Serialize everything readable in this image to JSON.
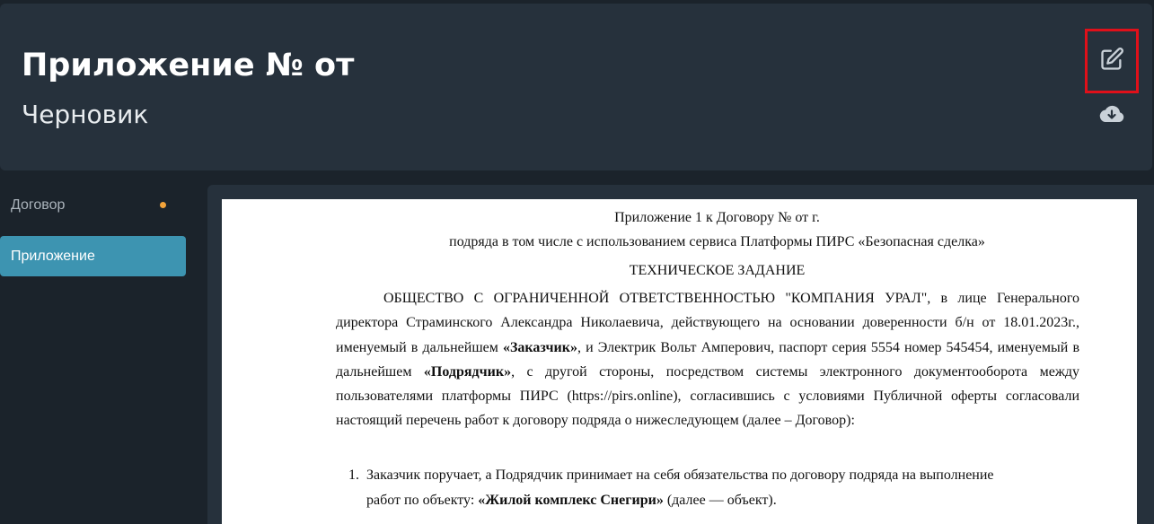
{
  "header": {
    "title": "Приложение № от",
    "status": "Черновик",
    "edit_icon": "edit-icon",
    "download_icon": "cloud-download-icon"
  },
  "sidebar": {
    "items": [
      {
        "label": "Договор",
        "indicator_color": "#f2a33a"
      },
      {
        "label": "Приложение",
        "active": true
      }
    ]
  },
  "document": {
    "heading_line1": "Приложение 1 к Договору № от г.",
    "heading_line2": "подряда в том числе с использованием сервиса Платформы ПИРС «Безопасная сделка»",
    "heading_line3": "ТЕХНИЧЕСКОЕ ЗАДАНИЕ",
    "para_part1": "ОБЩЕСТВО С ОГРАНИЧЕННОЙ ОТВЕТСТВЕННОСТЬЮ \"КОМПАНИЯ УРАЛ\", в лице Генерального директора Страминского Александра Николаевича, действующего на основании доверенности б/н от 18.01.2023г., именуемый в дальнейшем ",
    "para_bold1": "«Заказчик»",
    "para_part2": ", и Электрик Вольт Амперович, паспорт серия 5554 номер 545454, именуемый в дальнейшем ",
    "para_bold2": "«Подрядчик»",
    "para_part3": ", с другой стороны, посредством системы электронного документооборота между пользователями платформы ПИРС (https://pirs.online), согласившись с условиями Публичной оферты согласовали настоящий перечень работ к договору подряда о нижеследующем (далее – Договор):",
    "list_number": "1.",
    "list_part1": "Заказчик поручает, а Подрядчик принимает на себя обязательства по договору подряда на выполнение работ по объекту: ",
    "list_bold": "«Жилой комплекс Снегири»",
    "list_part2": " (далее — объект)."
  },
  "colors": {
    "accent": "#3d94b1",
    "highlight_border": "#e0101a",
    "header_bg": "#26313c",
    "page_bg": "#1b232b"
  }
}
